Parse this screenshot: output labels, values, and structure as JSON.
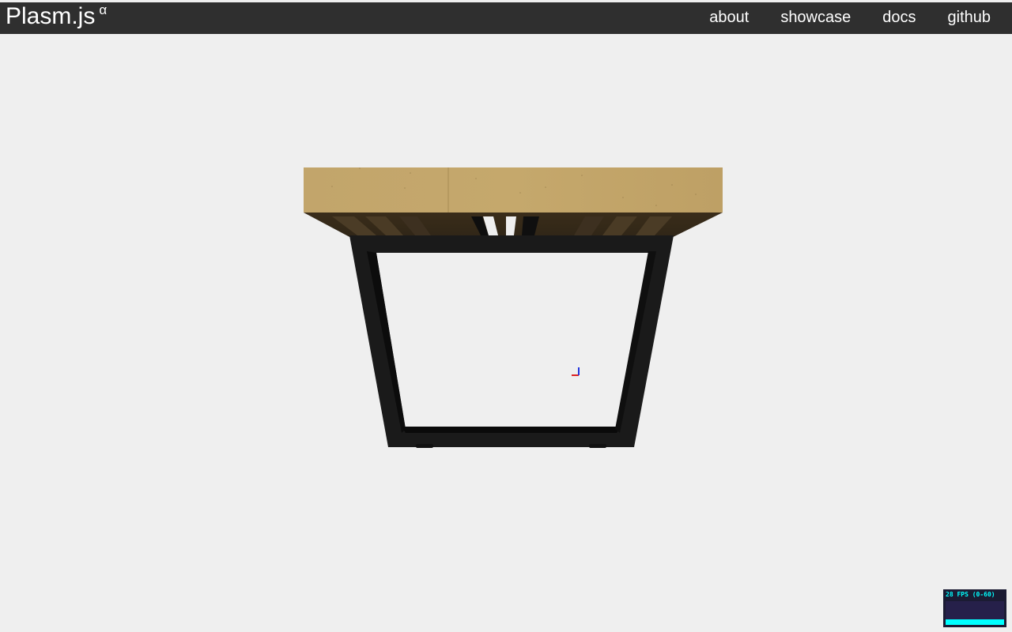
{
  "header": {
    "logo": "Plasm.js",
    "logo_sup": "α",
    "nav": [
      {
        "label": "about"
      },
      {
        "label": "showcase"
      },
      {
        "label": "docs"
      },
      {
        "label": "github"
      }
    ]
  },
  "stats": {
    "label": "28 FPS (0-60)",
    "fps": 28,
    "range": [
      0,
      60
    ]
  },
  "colors": {
    "header_bg": "#2f2f2f",
    "background": "#efefef",
    "wood": "#c3a56a",
    "frame": "#1a1a1a",
    "stats_accent": "#00ffff"
  }
}
